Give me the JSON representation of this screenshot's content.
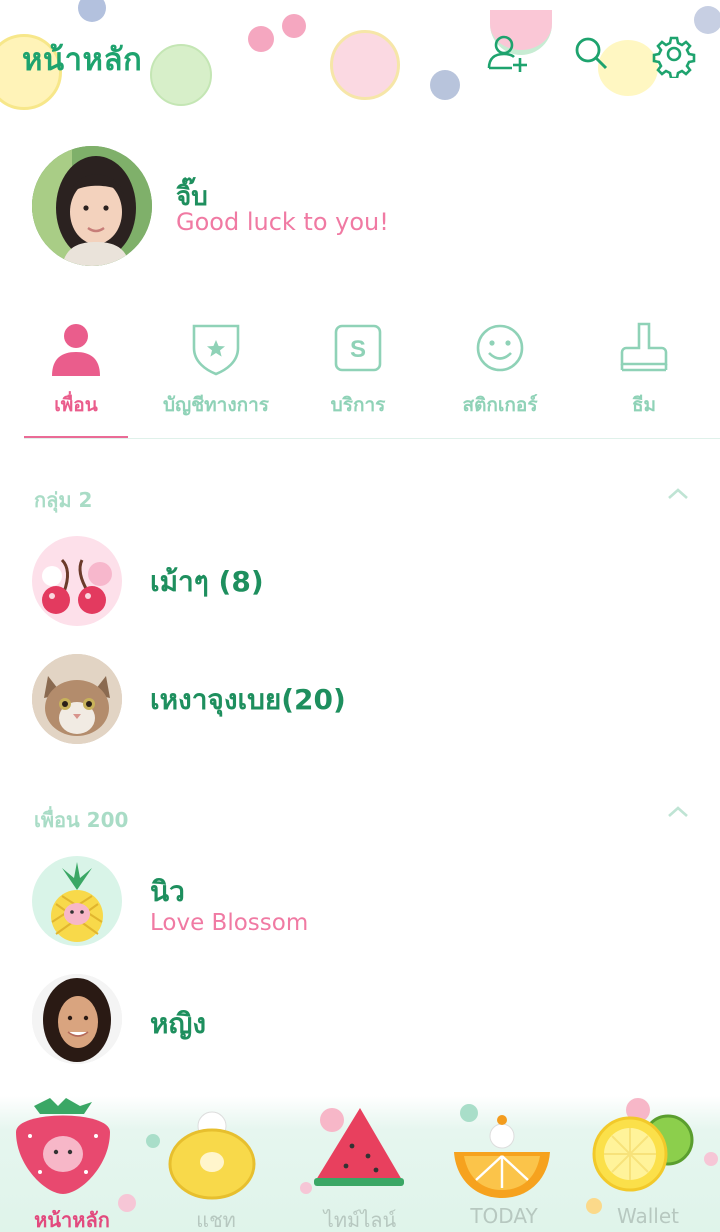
{
  "header": {
    "title": "หน้าหลัก",
    "icons": [
      "add-friend-icon",
      "search-icon",
      "settings-icon"
    ]
  },
  "profile": {
    "name": "จิ๊บ",
    "status": "Good luck to you!"
  },
  "tabs": [
    {
      "label": "เพื่อน",
      "icon": "person-icon",
      "active": true
    },
    {
      "label": "บัญชีทางการ",
      "icon": "shield-star-icon"
    },
    {
      "label": "บริการ",
      "icon": "service-s-icon"
    },
    {
      "label": "สติกเกอร์",
      "icon": "smiley-icon"
    },
    {
      "label": "ธีม",
      "icon": "brush-icon"
    }
  ],
  "groups": {
    "header": "กลุ่ม 2",
    "items": [
      {
        "name": "เม้าๆ (8)",
        "avatar": "cherry-avatar"
      },
      {
        "name": "เหงาจุงเบย(20)",
        "avatar": "cat-avatar"
      }
    ]
  },
  "friends": {
    "header": "เพื่อน 200",
    "items": [
      {
        "name": "นิว",
        "status": "Love Blossom",
        "avatar": "pineapple-avatar"
      },
      {
        "name": "หญิง",
        "status": "",
        "avatar": "woman-avatar"
      }
    ]
  },
  "bottom_nav": [
    {
      "label": "หน้าหลัก",
      "icon": "strawberry-icon",
      "active": true
    },
    {
      "label": "แชท",
      "icon": "pineapple-ring-icon"
    },
    {
      "label": "ไทม์ไลน์",
      "icon": "watermelon-icon"
    },
    {
      "label": "TODAY",
      "icon": "orange-slice-icon"
    },
    {
      "label": "Wallet",
      "icon": "lemon-icon"
    }
  ],
  "colors": {
    "accent_green": "#1ea36e",
    "accent_pink": "#ea5d8c",
    "mint": "#8fd2b7"
  }
}
